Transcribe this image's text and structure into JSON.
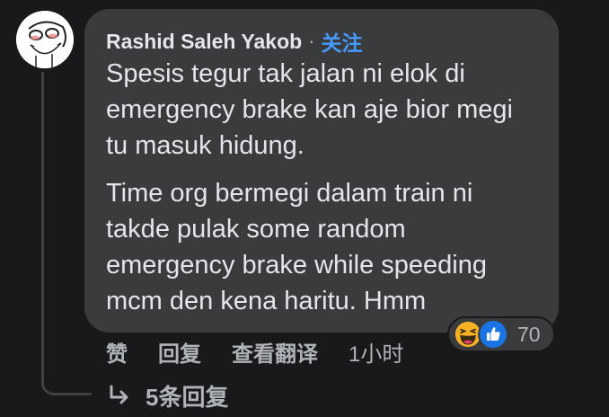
{
  "comment": {
    "author": "Rashid Saleh Yakob",
    "separator": "·",
    "follow_label": "关注",
    "paragraphs": [
      "Spesis tegur tak jalan ni elok di\nemergency brake kan aje bior megi\ntu masuk hidung.",
      "Time org bermegi dalam train ni\ntakde pulak some random\nemergency brake while speeding\nmcm den kena haritu. Hmm"
    ],
    "reactions": {
      "icons": [
        "haha-icon",
        "like-icon"
      ],
      "count": "70"
    },
    "actions": {
      "like_label": "赞",
      "reply_label": "回复",
      "translate_label": "查看翻译",
      "timestamp": "1小时"
    },
    "replies": {
      "icon": "reply-arrow-icon",
      "label": "5条回复"
    }
  },
  "colors": {
    "background": "#18191a",
    "bubble": "#3a3b3c",
    "text": "#e4e6eb",
    "secondary_text": "#b0b3b8",
    "link": "#4599ff",
    "like_blue": "#1b74e4",
    "haha_yellow": "#f7b125"
  }
}
